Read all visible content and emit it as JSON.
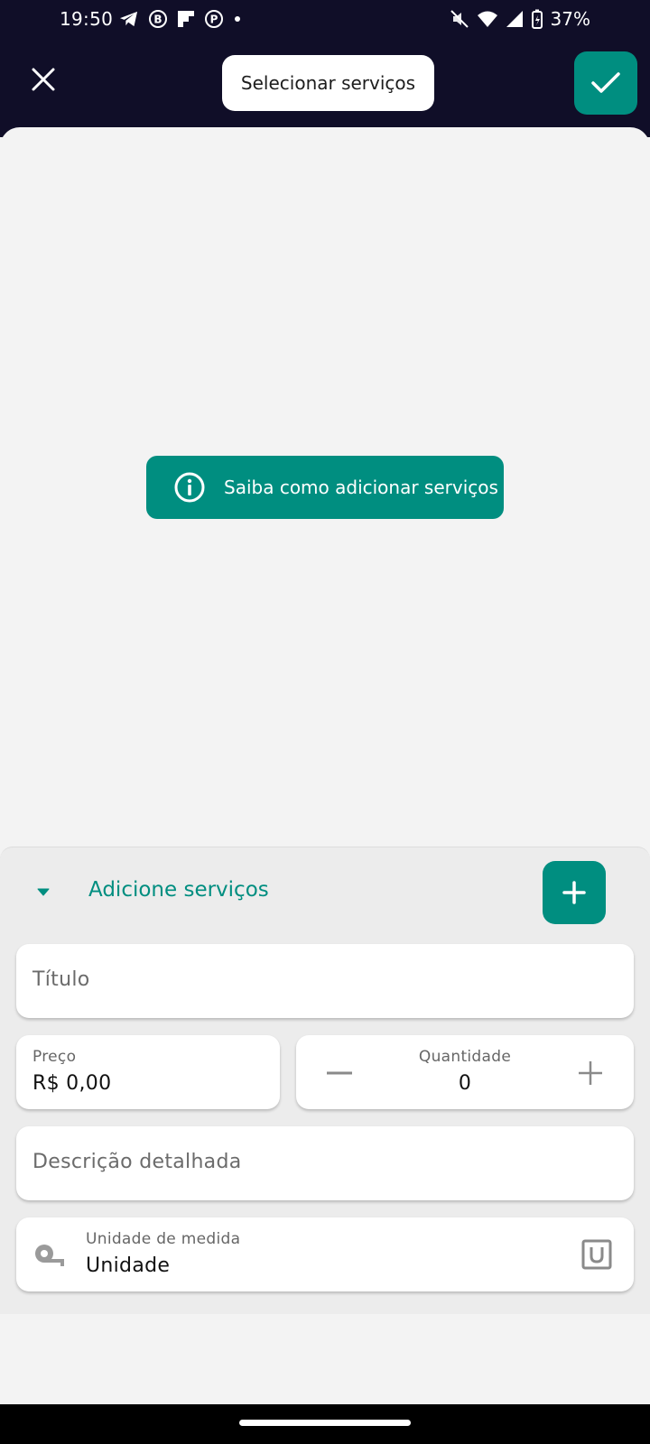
{
  "status_bar": {
    "time": "19:50",
    "battery": "37%",
    "left_icons": [
      "telegram-icon",
      "b-badge-icon",
      "flipboard-icon",
      "pinterest-icon",
      "dot-icon"
    ],
    "right_icons": [
      "mute-icon",
      "wifi-icon",
      "signal-icon",
      "battery-icon"
    ]
  },
  "header": {
    "title": "Selecionar serviços",
    "close_icon": "close-icon",
    "confirm_icon": "check-icon"
  },
  "main": {
    "info_button_label": "Saiba como adicionar serviços"
  },
  "panel": {
    "title": "Adicione serviços",
    "fields": {
      "title_placeholder": "Título",
      "price_label": "Preço",
      "price_value": "R$ 0,00",
      "quantity_label": "Quantidade",
      "quantity_value": "0",
      "description_placeholder": "Descrição detalhada",
      "unit_label": "Unidade de medida",
      "unit_value": "Unidade"
    }
  },
  "colors": {
    "accent": "#008e80",
    "header_bg": "#100e28",
    "surface": "#f3f3f3",
    "panel_bg": "#ececec"
  }
}
